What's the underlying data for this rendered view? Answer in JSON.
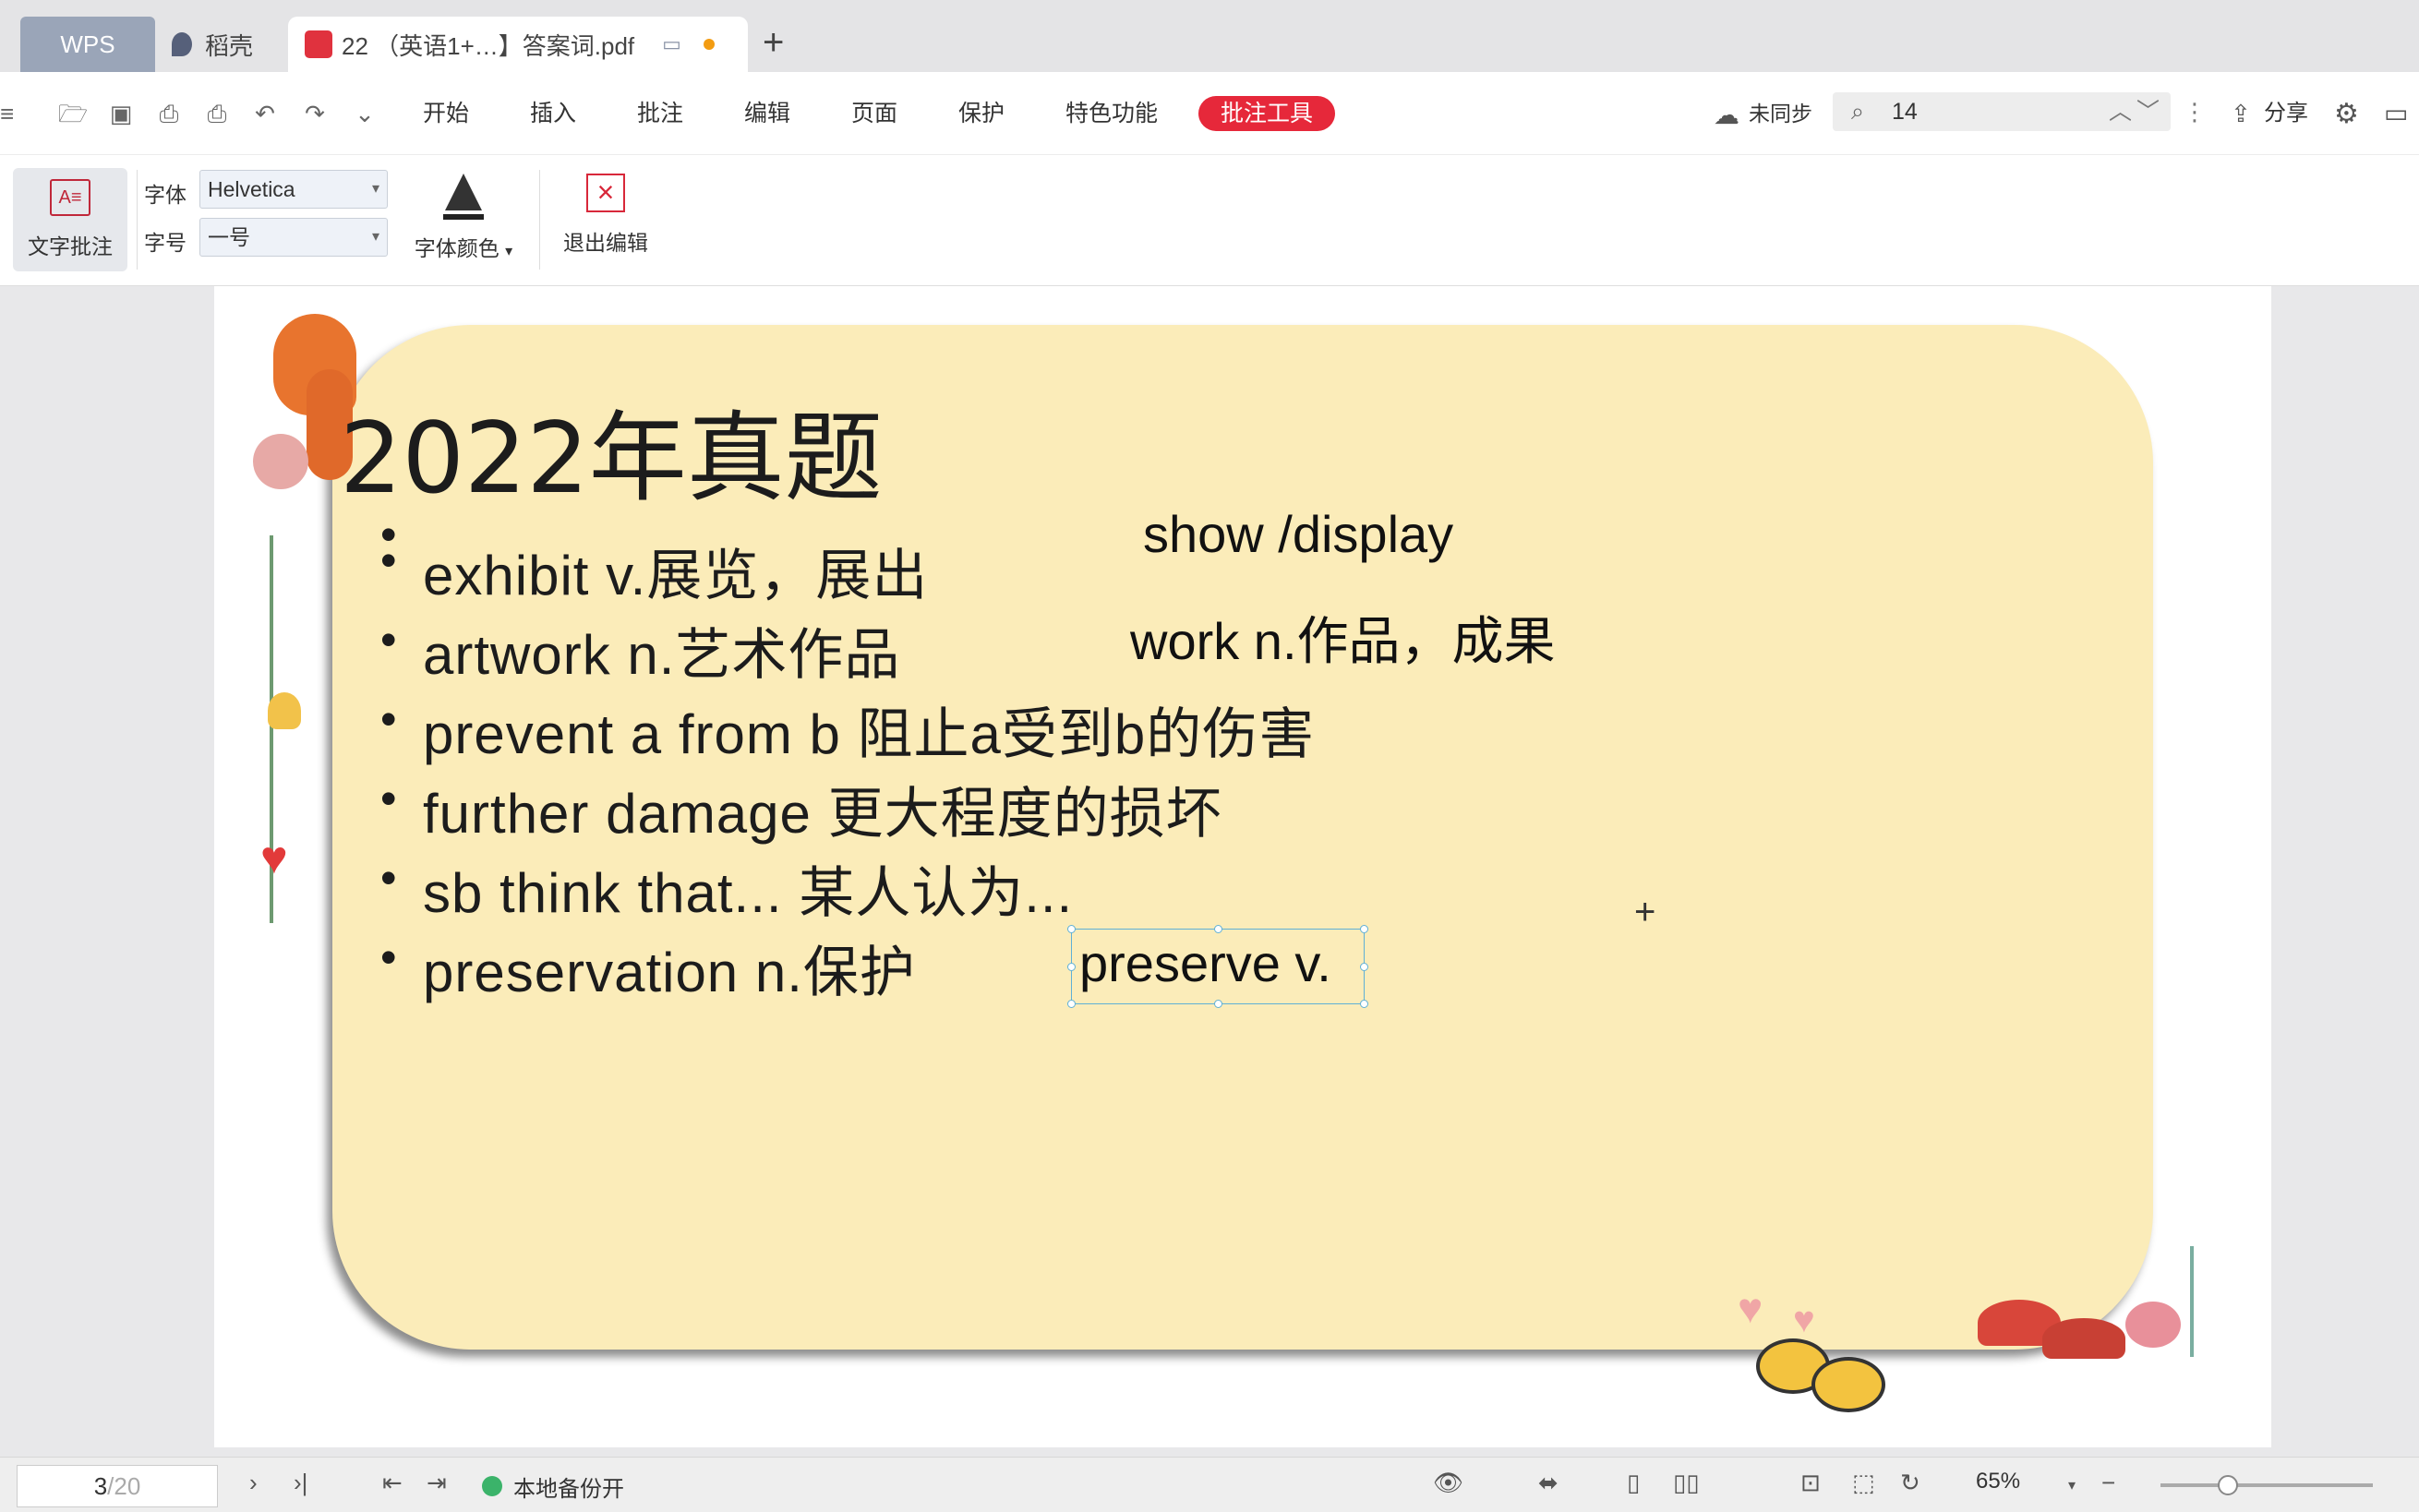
{
  "tabs": {
    "wps": "WPS",
    "daoke": "稻壳",
    "document": "22 （英语1+…】答案词.pdf"
  },
  "menu": {
    "items": [
      "开始",
      "插入",
      "批注",
      "编辑",
      "页面",
      "保护",
      "特色功能"
    ],
    "active_tool": "批注工具",
    "sync_status": "未同步",
    "search_value": "14",
    "share": "分享"
  },
  "ribbon": {
    "text_annotation": "文字批注",
    "font_label": "字体",
    "font_value": "Helvetica",
    "size_label": "字号",
    "size_value": "一号",
    "font_color": "字体颜色",
    "exit_edit": "退出编辑"
  },
  "slide": {
    "title": "2022年真题",
    "vocab": [
      "exhibit  v.展览，展出",
      "artwork  n.艺术作品",
      "prevent  a  from  b  阻止a受到b的伤害",
      "further  damage  更大程度的损坏",
      "sb  think  that...  某人认为...",
      "preservation  n.保护"
    ],
    "annotations": [
      "show /display",
      "work n.作品，成果",
      "preserve v."
    ]
  },
  "status": {
    "page_current": "3",
    "page_total": "/20",
    "backup": "本地备份开",
    "zoom": "65%"
  },
  "colors": {
    "accent": "#e6283a",
    "card": "#fbecb9",
    "selection": "#5fb0d6"
  }
}
